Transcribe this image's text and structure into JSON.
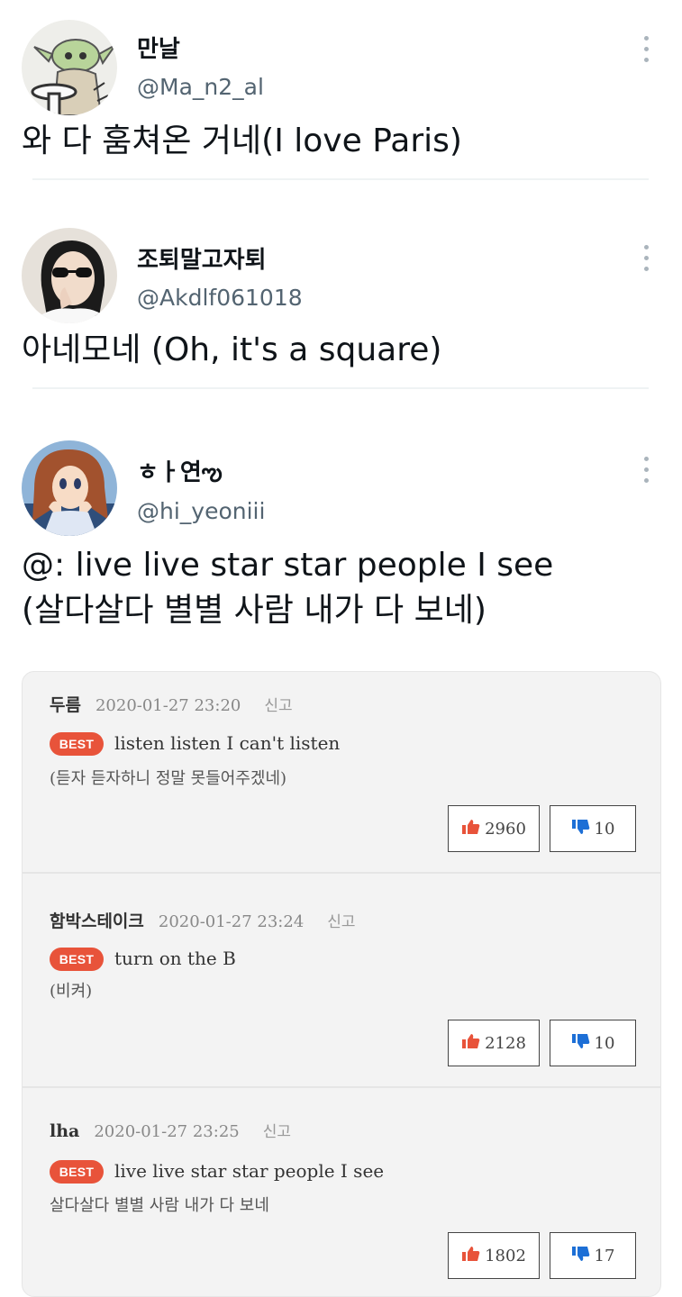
{
  "tweets": [
    {
      "name": "만날",
      "handle": "@Ma_n2_al",
      "text_lines": [
        "와 다 훔쳐온 거네(I love Paris)"
      ]
    },
    {
      "name": "조퇴말고자퇴",
      "handle": "@Akdlf061018",
      "text_lines": [
        "아네모네 (Oh, it's a square)"
      ]
    },
    {
      "name": "ㅎㅏ연ఌ",
      "handle": "@hi_yeoniii",
      "text_lines": [
        "@: live live star star people I see",
        "(살다살다 별별 사람 내가 다 보네)"
      ]
    }
  ],
  "comments": [
    {
      "user": "두름",
      "date": "2020-01-27 23:20",
      "report": "신고",
      "badge": "BEST",
      "text": "listen listen I can't listen",
      "sub": "(듣자 듣자하니 정말 못들어주겠네)",
      "likes": "2960",
      "dislikes": "10"
    },
    {
      "user": "함박스테이크",
      "date": "2020-01-27 23:24",
      "report": "신고",
      "badge": "BEST",
      "text": "turn on the B",
      "sub": "(비켜)",
      "likes": "2128",
      "dislikes": "10"
    },
    {
      "user": "lha",
      "date": "2020-01-27 23:25",
      "report": "신고",
      "badge": "BEST",
      "text": "live live star star people I see",
      "sub": "살다살다 별별 사람 내가 다 보네",
      "likes": "1802",
      "dislikes": "17"
    }
  ],
  "colors": {
    "handle": "#536471",
    "best_badge": "#e8533a",
    "like_icon": "#e8533a",
    "dislike_icon": "#1d6fd6"
  },
  "icons": {
    "more": "more-vertical-icon",
    "like": "thumbs-up-icon",
    "dislike": "thumbs-down-icon"
  }
}
